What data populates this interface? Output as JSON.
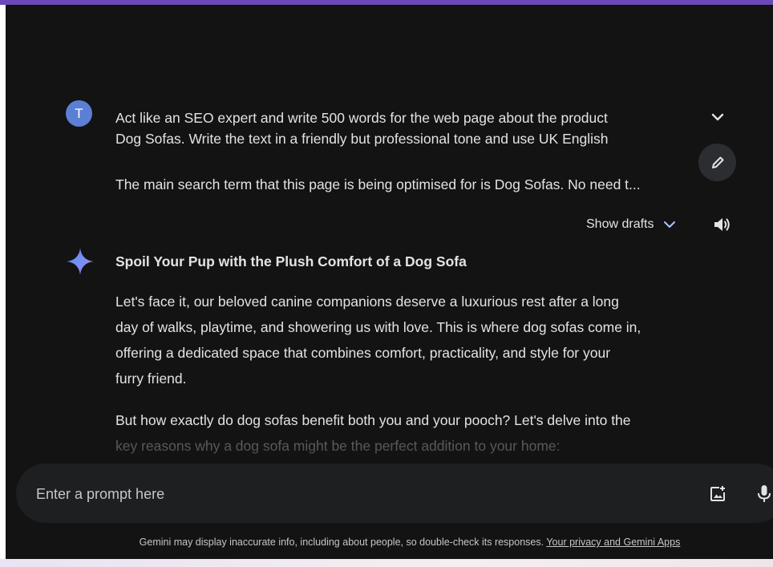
{
  "user": {
    "avatar_letter": "T",
    "prompt_lines": [
      "Act like an SEO expert and write 500 words for the web page about the product",
      "Dog Sofas. Write the text in a friendly but professional tone and use UK English",
      "The main search term that this page is being optimised for is Dog Sofas. No need t..."
    ]
  },
  "actions": {
    "show_drafts_label": "Show drafts",
    "icons": [
      "chevron-down-icon",
      "pencil-icon",
      "speaker-icon",
      "gemini-spark-icon",
      "add-image-icon",
      "microphone-icon"
    ]
  },
  "response": {
    "title": "Spoil Your Pup with the Plush Comfort of a Dog Sofa",
    "paragraph1_lines": [
      "Let's face it, our beloved canine companions deserve a luxurious rest after a long",
      "day of walks, playtime, and showering us with love.  This is where dog sofas come in,",
      "offering a dedicated space that combines comfort, practicality, and style for your",
      "furry friend."
    ],
    "paragraph2_lines": [
      "But how exactly do dog sofas benefit both you and your pooch? Let's delve into the",
      "key reasons why a dog sofa might be the perfect addition to your home:"
    ]
  },
  "input": {
    "placeholder": "Enter a prompt here",
    "value": ""
  },
  "footer": {
    "disclaimer": "Gemini may display inaccurate info, including about people, so double-check its responses. ",
    "link_text": "Your privacy and Gemini Apps"
  },
  "colors": {
    "background": "#131314",
    "top_border": "#6b49b8",
    "avatar": "#5c7fd6",
    "text": "#e3e3e3",
    "input_bar": "#1e1f20",
    "chevron_accent": "#a8c7fa"
  }
}
